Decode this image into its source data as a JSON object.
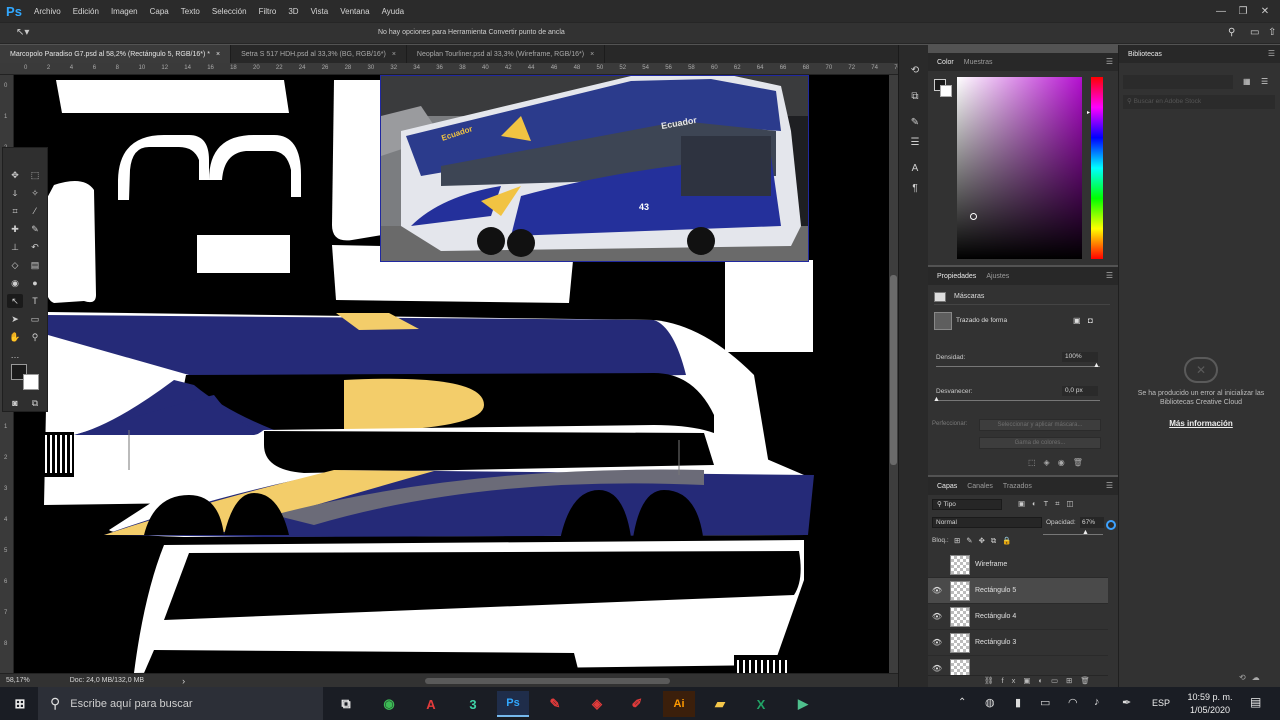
{
  "app": {
    "logo": "Ps"
  },
  "menu": [
    "Archivo",
    "Edición",
    "Imagen",
    "Capa",
    "Texto",
    "Selección",
    "Filtro",
    "3D",
    "Vista",
    "Ventana",
    "Ayuda"
  ],
  "options_bar": {
    "message": "No hay opciones para Herramienta Convertir punto de ancla"
  },
  "doc_tabs": [
    {
      "label": "Marcopolo Paradiso G7.psd al 58,2% (Rectángulo 5, RGB/16*) *",
      "close": "×"
    },
    {
      "label": "Setra S 517 HDH.psd al 33,3% (BG, RGB/16*)",
      "close": "×"
    },
    {
      "label": "Neoplan Tourliner.psd al 33,3% (Wireframe, RGB/16*)",
      "close": "×"
    }
  ],
  "ruler": {
    "top": [
      "0",
      "2",
      "4",
      "6",
      "8",
      "10",
      "12",
      "14",
      "16",
      "18",
      "20",
      "22",
      "24",
      "26",
      "28",
      "30",
      "32",
      "34",
      "36",
      "38",
      "40",
      "42",
      "44",
      "46",
      "48",
      "50",
      "52",
      "54",
      "56",
      "58",
      "60",
      "62",
      "64",
      "66",
      "68",
      "70",
      "72",
      "74",
      "76"
    ],
    "left": [
      "0",
      "1",
      "2",
      "3",
      "4",
      "5",
      "6",
      "7",
      "8",
      "9",
      "0",
      "1",
      "2",
      "3",
      "4",
      "5",
      "6",
      "7",
      "8"
    ]
  },
  "status": {
    "zoom": "58,17%",
    "doc": "Doc: 24,0 MB/132,0 MB",
    "arrow": "›"
  },
  "reference_photo": {
    "livery_text": "Ecuador",
    "number": "43"
  },
  "color_panel": {
    "tabs": [
      "Color",
      "Muestras"
    ],
    "foreground": "#1a1a1a",
    "background": "#ffffff",
    "hue_color": "#b40fd0"
  },
  "properties_panel": {
    "tabs": [
      "Propiedades",
      "Ajustes"
    ],
    "section": "Máscaras",
    "mask_label": "Trazado de forma",
    "density_label": "Densidad:",
    "density_value": "100%",
    "feather_label": "Desvanecer:",
    "feather_value": "0,0 px",
    "refine_label": "Perfeccionar:",
    "refine_btn": "Seleccionar y aplicar máscara...",
    "color_range_btn": "Gama de colores..."
  },
  "layers_panel": {
    "tabs": [
      "Capas",
      "Canales",
      "Trazados"
    ],
    "filter": "Tipo",
    "blend_mode": "Normal",
    "opacity_label": "Opacidad:",
    "opacity_value": "67%",
    "lock_label": "Bloq.:",
    "layers": [
      {
        "name": "Wireframe",
        "visible": false
      },
      {
        "name": "Rectángulo 5",
        "visible": true,
        "selected": true
      },
      {
        "name": "Rectángulo 4",
        "visible": true
      },
      {
        "name": "Rectángulo 3",
        "visible": true
      }
    ]
  },
  "libraries_panel": {
    "title": "Bibliotecas",
    "search_placeholder": "Buscar en Adobe Stock",
    "error_text": "Se ha producido un error al inicializar las Bibliotecas Creative Cloud",
    "more_info": "Más información"
  },
  "taskbar": {
    "search_placeholder": "Escribe aquí para buscar",
    "language": "ESP",
    "time": "10:59 p. m.",
    "date": "1/05/2020",
    "apps": [
      "A",
      "3",
      "Ps",
      "Ai"
    ]
  }
}
